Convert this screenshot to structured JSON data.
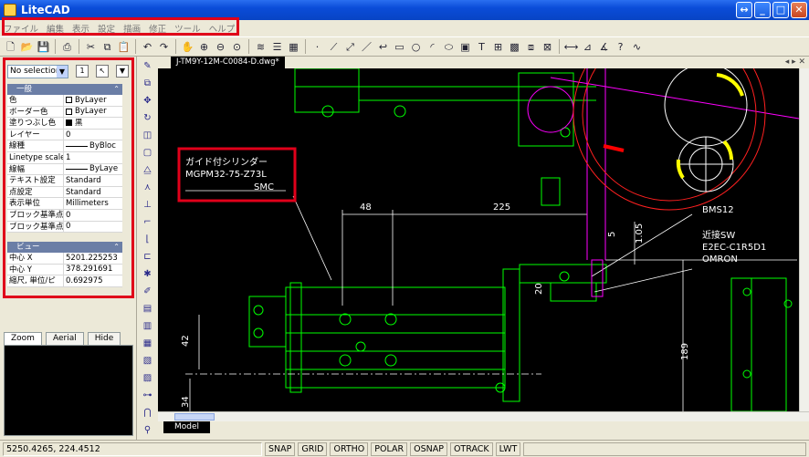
{
  "window": {
    "title": "LiteCAD"
  },
  "menu": {
    "items": [
      "ファイル",
      "編集",
      "表示",
      "設定",
      "描画",
      "修正",
      "ツール",
      "ヘルプ"
    ]
  },
  "toolbar": {
    "icons": [
      "new-file-icon",
      "open-folder-icon",
      "save-icon",
      "print-icon",
      "cut-icon",
      "copy-icon",
      "paste-icon",
      "undo-icon",
      "redo-icon",
      "pan-icon",
      "zoom-in-icon",
      "zoom-out-icon",
      "zoom-window-icon",
      "layers-icon",
      "line-types-icon",
      "block-icon",
      "point-icon",
      "line-icon",
      "polyline-icon",
      "rectangle-icon",
      "circle-icon",
      "arc-icon",
      "ellipse-icon",
      "image-icon",
      "text-icon",
      "insert-block-icon",
      "hatch-icon",
      "dimension-icon",
      "help-icon"
    ]
  },
  "properties": {
    "selection": "No selection",
    "general_header": "一般",
    "general": [
      {
        "key": "色",
        "value": "ByLayer",
        "swatch": "white"
      },
      {
        "key": "ボーダー色",
        "value": "ByLayer",
        "swatch": "white"
      },
      {
        "key": "塗りつぶし色",
        "value": "黒",
        "swatch": "black"
      },
      {
        "key": "レイヤー",
        "value": "0"
      },
      {
        "key": "線種",
        "value": "ByBloc",
        "line": true
      },
      {
        "key": "Linetype scale",
        "value": "1"
      },
      {
        "key": "線幅",
        "value": "ByLaye",
        "line": true
      },
      {
        "key": "テキスト設定",
        "value": "Standard"
      },
      {
        "key": "点設定",
        "value": "Standard"
      },
      {
        "key": "表示単位",
        "value": "Millimeters"
      },
      {
        "key": "ブロック基準点",
        "value": "0"
      },
      {
        "key": "ブロック基準点",
        "value": "0"
      }
    ],
    "view_header": "ビュー",
    "view": [
      {
        "key": "中心 X",
        "value": "5201.225253"
      },
      {
        "key": "中心 Y",
        "value": "378.291691"
      },
      {
        "key": "縮尺, 単位/ピ",
        "value": "0.692975"
      }
    ]
  },
  "nav_tabs": [
    "Zoom",
    "Aerial",
    "Hide"
  ],
  "document": {
    "tab_label": "J-TM9Y-12M-C0084-D.dwg*"
  },
  "drawing": {
    "note_line1": "ガイド付シリンダー",
    "note_line2": "MGPM32-75-Z73L",
    "note_line3": "SMC",
    "dim_48": "48",
    "dim_225": "225",
    "dim_105": "1.05",
    "dim_5": "5",
    "dim_42": "42",
    "dim_189": "189",
    "dim_34": "34",
    "dim_20": "20",
    "label_bms": "BMS12",
    "label_sw1": "近接SW",
    "label_sw2": "E2EC-C1R5D1",
    "label_omron": "OMRON"
  },
  "model_tab": "Model",
  "status": {
    "coords": "5250.4265,  224.4512",
    "modes": [
      "SNAP",
      "GRID",
      "ORTHO",
      "POLAR",
      "OSNAP",
      "OTRACK",
      "LWT"
    ]
  },
  "colors": {
    "cad_green": "#00ff00",
    "cad_white": "#ffffff",
    "cad_magenta": "#ff00ff",
    "cad_red": "#ff0000",
    "cad_yellow": "#ffff00",
    "cad_blue": "#4060ff",
    "highlight": "#e0001a"
  }
}
